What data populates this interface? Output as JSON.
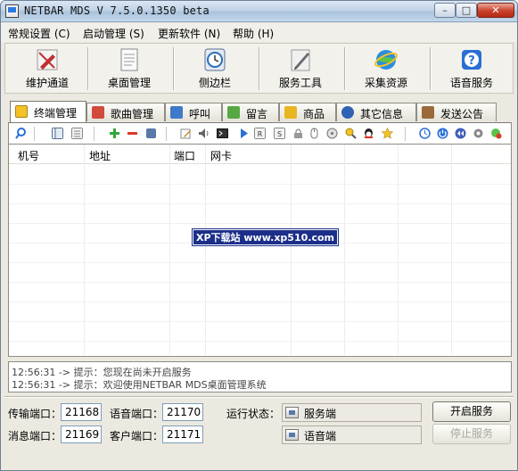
{
  "window": {
    "title": "NETBAR MDS V 7.5.0.1350 beta"
  },
  "menubar": [
    {
      "label": "常规设置 (C)"
    },
    {
      "label": "启动管理 (S)"
    },
    {
      "label": "更新软件 (N)"
    },
    {
      "label": "帮助 (H)"
    }
  ],
  "toolbar": [
    {
      "label": "维护通道",
      "icon": "pencil-icon",
      "color": "#c03030"
    },
    {
      "label": "桌面管理",
      "icon": "document-icon",
      "color": "#8a8a8a"
    },
    {
      "label": "侧边栏",
      "icon": "clock-icon",
      "color": "#2d6fb6"
    },
    {
      "label": "服务工具",
      "icon": "pen-icon",
      "color": "#6a6a6a"
    },
    {
      "label": "采集资源",
      "icon": "globe-icon",
      "color": "#2a8de0"
    },
    {
      "label": "语音服务",
      "icon": "help-icon",
      "color": "#2a6fd6"
    }
  ],
  "tabs": [
    {
      "label": "终端管理",
      "icon": "terminal-icon",
      "color": "#f2c227",
      "active": true
    },
    {
      "label": "歌曲管理",
      "icon": "music-icon",
      "color": "#d14a3a",
      "active": false
    },
    {
      "label": "呼叫",
      "icon": "call-icon",
      "color": "#3f79c9",
      "active": false
    },
    {
      "label": "留言",
      "icon": "message-icon",
      "color": "#57a842",
      "active": false
    },
    {
      "label": "商品",
      "icon": "mail-icon",
      "color": "#e9b520",
      "active": false
    },
    {
      "label": "其它信息",
      "icon": "info-icon",
      "color": "#2f62b5",
      "active": false
    },
    {
      "label": "发送公告",
      "icon": "announce-icon",
      "color": "#9a6a3a",
      "active": false
    }
  ],
  "grid": {
    "columns": [
      "机号",
      "地址",
      "端口",
      "网卡"
    ],
    "rows": []
  },
  "watermark": "XP下载站 www.xp510.com",
  "log": [
    "12:56:31 -> 提示：您现在尚未开启服务",
    "12:56:31 -> 提示：欢迎使用NETBAR MDS桌面管理系统"
  ],
  "ports": {
    "transfer_label": "传输端口：",
    "transfer_value": "21168",
    "voice_label": "语音端口：",
    "voice_value": "21170",
    "message_label": "消息端口：",
    "message_value": "21169",
    "client_label": "客户端口：",
    "client_value": "21171"
  },
  "status": {
    "label": "运行状态：",
    "server": "服务端",
    "voice": "语音端"
  },
  "buttons": {
    "start": "开启服务",
    "stop": "停止服务"
  },
  "colors": {
    "accent": "#2a6fd6",
    "watermark_bg": "#1b2f8a"
  }
}
